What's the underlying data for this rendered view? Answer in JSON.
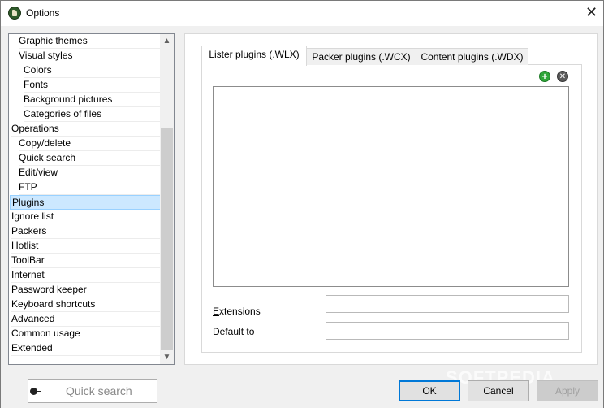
{
  "window": {
    "title": "Options",
    "close": "✕"
  },
  "tree": {
    "items": [
      "Graphic themes",
      "Visual styles",
      "Colors",
      "Fonts",
      "Background pictures",
      "Categories of files",
      "Operations",
      "Copy/delete",
      "Quick search",
      "Edit/view",
      "FTP",
      "Plugins",
      "Ignore list",
      "Packers",
      "Hotlist",
      "ToolBar",
      "Internet",
      "Password keeper",
      "Keyboard shortcuts",
      "Advanced",
      "Common usage",
      "Extended"
    ],
    "selected": "Plugins"
  },
  "tabs": [
    "Lister plugins (.WLX)",
    "Packer plugins (.WCX)",
    "Content plugins (.WDX)"
  ],
  "active_tab": "Lister plugins (.WLX)",
  "fields": {
    "extensions_first": "E",
    "extensions_rest": "xtensions",
    "default_first": "D",
    "default_rest": "efault to"
  },
  "bottom": {
    "quick_search_placeholder": "Quick search",
    "ok": "OK",
    "cancel": "Cancel",
    "apply": "Apply",
    "watermark": "SOFTPEDIA"
  },
  "colors": {
    "selection": "#cce8ff",
    "add_icon": "#2fa639",
    "default_button_border": "#0078d7"
  }
}
